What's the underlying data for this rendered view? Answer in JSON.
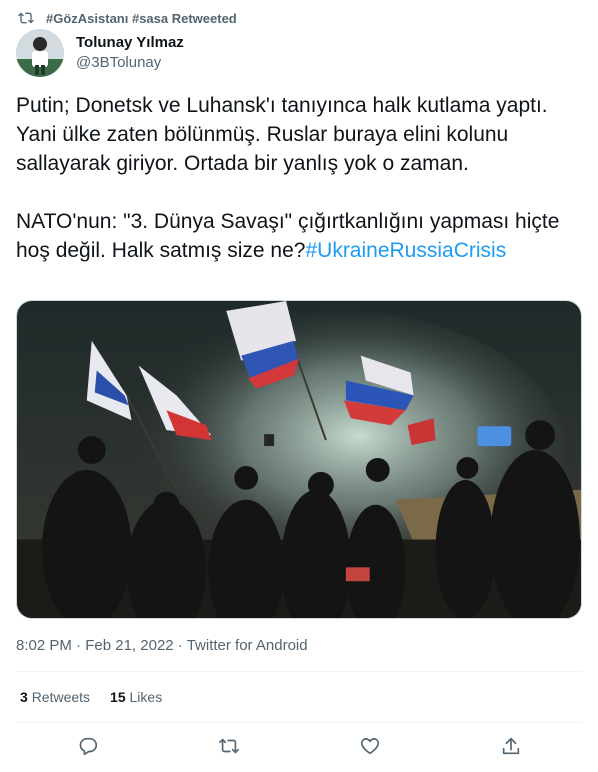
{
  "retweet_banner": {
    "text": "#GözAsistanı #sasa Retweeted"
  },
  "author": {
    "display_name": "Tolunay Yılmaz",
    "handle": "@3BTolunay"
  },
  "tweet": {
    "text": "Putin; Donetsk ve Luhansk'ı tanıyınca halk kutlama yaptı. Yani ülke zaten bölünmüş. Ruslar buraya elini kolunu sallayarak giriyor. Ortada bir yanlış yok o zaman.\n\nNATO'nun: \"3. Dünya Savaşı\" çığırtkanlığını yapması hiçte hoş değil. Halk satmış size ne?",
    "hashtag": "#UkraineRussiaCrisis"
  },
  "meta": {
    "time": "8:02 PM",
    "separator": "·",
    "date": "Feb 21, 2022",
    "source": "Twitter for Android"
  },
  "stats": {
    "retweets_count": "3",
    "retweets_label": "Retweets",
    "likes_count": "15",
    "likes_label": "Likes"
  },
  "colors": {
    "accent": "#1d9bf0",
    "muted": "#536471",
    "text": "#0f1419"
  },
  "icons": [
    "retweet-icon",
    "reply-icon",
    "like-icon",
    "share-icon"
  ]
}
